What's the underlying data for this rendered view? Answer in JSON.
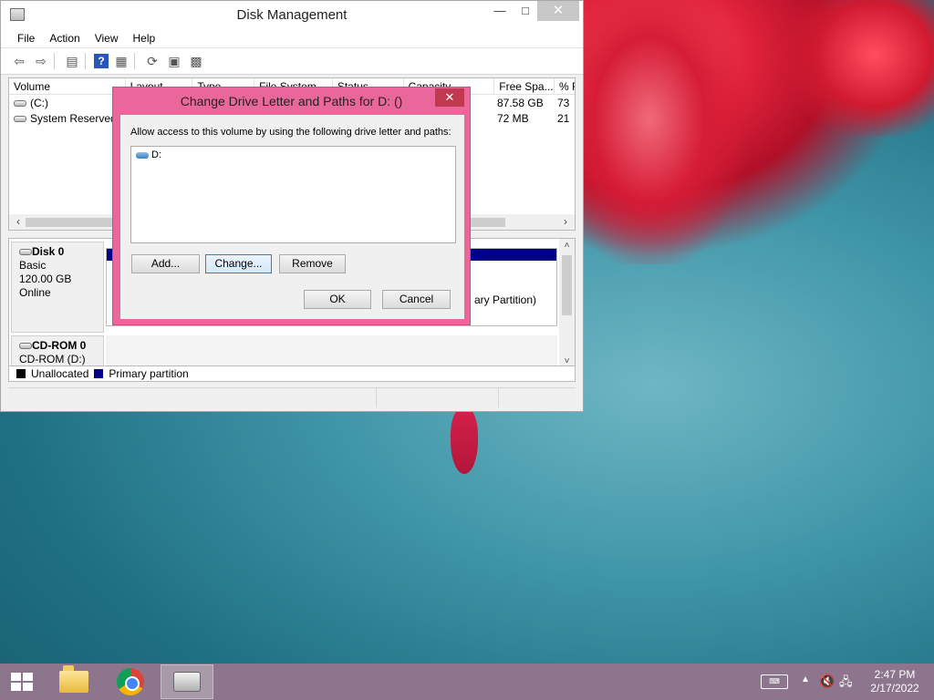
{
  "window": {
    "title": "Disk Management",
    "menus": [
      "File",
      "Action",
      "View",
      "Help"
    ],
    "minimize": "—",
    "maximize": "□",
    "close": "✕"
  },
  "volume_list": {
    "columns": [
      "Volume",
      "Layout",
      "Type",
      "File System",
      "Status",
      "Capacity",
      "Free Spa...",
      "% F"
    ],
    "rows": [
      {
        "volume": "(C:)",
        "free": "87.58 GB",
        "pct": "73"
      },
      {
        "volume": "System Reserved",
        "free": "72 MB",
        "pct": "21"
      }
    ]
  },
  "disks": {
    "disk0": {
      "name": "Disk 0",
      "type": "Basic",
      "size": "120.00 GB",
      "status": "Online"
    },
    "partition_text": "ary Partition)",
    "cdrom": {
      "name": "CD-ROM 0",
      "drive": "CD-ROM (D:)"
    }
  },
  "legend": {
    "unallocated": "Unallocated",
    "primary": "Primary partition",
    "colors": {
      "unallocated": "#000000",
      "primary": "#00008b"
    }
  },
  "dialog": {
    "title": "Change Drive Letter and Paths for D: ()",
    "instruction": "Allow access to this volume by using the following drive letter and paths:",
    "paths": [
      "D:"
    ],
    "buttons": {
      "add": "Add...",
      "change": "Change...",
      "remove": "Remove",
      "ok": "OK",
      "cancel": "Cancel"
    },
    "close": "✕"
  },
  "taskbar": {
    "time": "2:47 PM",
    "date": "2/17/2022",
    "apps": [
      "file-explorer",
      "chrome",
      "disk-management"
    ]
  }
}
